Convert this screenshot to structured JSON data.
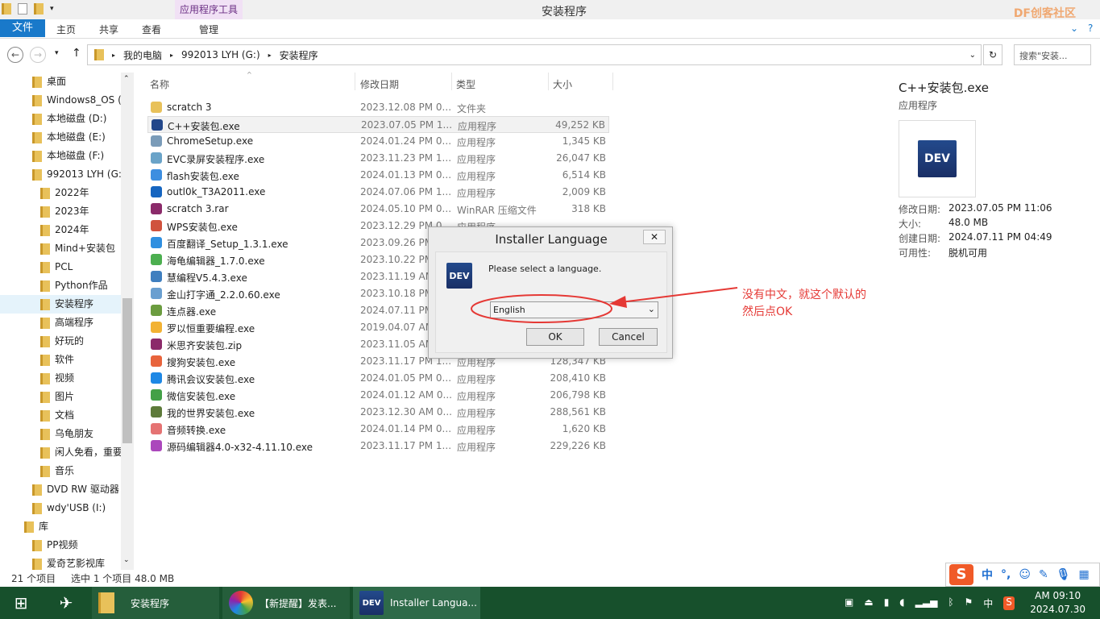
{
  "window": {
    "title": "安装程序",
    "context_tab": "应用程序工具",
    "watermark": "DF创客社区"
  },
  "ribbon": {
    "tabs": [
      "文件",
      "主页",
      "共享",
      "查看",
      "管理"
    ]
  },
  "address": {
    "crumbs": [
      "我的电脑",
      "992013 LYH (G:)",
      "安装程序"
    ],
    "search_placeholder": "搜索\"安装..."
  },
  "nav": [
    "桌面",
    "Windows8_OS (",
    "本地磁盘 (D:)",
    "本地磁盘 (E:)",
    "本地磁盘 (F:)",
    "992013 LYH (G:",
    "2022年",
    "2023年",
    "2024年",
    "Mind+安装包",
    "PCL",
    "Python作品",
    "安装程序",
    "高端程序",
    "好玩的",
    "软件",
    "视频",
    "图片",
    "文档",
    "乌龟朋友",
    "闲人免看，重要",
    "音乐",
    "DVD RW 驱动器",
    "wdy'USB (I:)",
    "库",
    "PP视频",
    "爱奇艺影视库"
  ],
  "columns": [
    "名称",
    "修改日期",
    "类型",
    "大小"
  ],
  "files": [
    {
      "name": "scratch 3",
      "date": "2023.12.08 PM 0...",
      "type": "文件夹",
      "size": "",
      "color": "#e8c15a"
    },
    {
      "name": "C++安装包.exe",
      "date": "2023.07.05 PM 1...",
      "type": "应用程序",
      "size": "49,252 KB",
      "color": "#23478a"
    },
    {
      "name": "ChromeSetup.exe",
      "date": "2024.01.24 PM 0...",
      "type": "应用程序",
      "size": "1,345 KB",
      "color": "#7a9bb8"
    },
    {
      "name": "EVC录屏安装程序.exe",
      "date": "2023.11.23 PM 1...",
      "type": "应用程序",
      "size": "26,047 KB",
      "color": "#6aa3c8"
    },
    {
      "name": "flash安装包.exe",
      "date": "2024.01.13 PM 0...",
      "type": "应用程序",
      "size": "6,514 KB",
      "color": "#3d8ee0"
    },
    {
      "name": "outl0k_T3A2011.exe",
      "date": "2024.07.06 PM 1...",
      "type": "应用程序",
      "size": "2,009 KB",
      "color": "#1565c0"
    },
    {
      "name": "scratch 3.rar",
      "date": "2024.05.10 PM 0...",
      "type": "WinRAR 压缩文件",
      "size": "318 KB",
      "color": "#8b2a6a"
    },
    {
      "name": "WPS安装包.exe",
      "date": "2023.12.29 PM 0...",
      "type": "应用程序",
      "size": "",
      "color": "#d0523d"
    },
    {
      "name": "百度翻译_Setup_1.3.1.exe",
      "date": "2023.09.26 PM",
      "type": "",
      "size": "",
      "color": "#2f8fe0"
    },
    {
      "name": "海龟编辑器_1.7.0.exe",
      "date": "2023.10.22 PM",
      "type": "",
      "size": "",
      "color": "#4caf50"
    },
    {
      "name": "慧编程V5.4.3.exe",
      "date": "2023.11.19 AM",
      "type": "",
      "size": "",
      "color": "#3f7fbf"
    },
    {
      "name": "金山打字通_2.2.0.60.exe",
      "date": "2023.10.18 PM",
      "type": "",
      "size": "",
      "color": "#6a9fd0"
    },
    {
      "name": "连点器.exe",
      "date": "2024.07.11 PM",
      "type": "",
      "size": "",
      "color": "#6b9c3f"
    },
    {
      "name": "罗以恒重要编程.exe",
      "date": "2019.04.07 AM",
      "type": "",
      "size": "",
      "color": "#f2b233"
    },
    {
      "name": "米思齐安装包.zip",
      "date": "2023.11.05 AM",
      "type": "",
      "size": "",
      "color": "#8b2a6a"
    },
    {
      "name": "搜狗安装包.exe",
      "date": "2023.11.17 PM 1...",
      "type": "应用程序",
      "size": "128,347 KB",
      "color": "#e8643c"
    },
    {
      "name": "腾讯会议安装包.exe",
      "date": "2024.01.05 PM 0...",
      "type": "应用程序",
      "size": "208,410 KB",
      "color": "#1e88e5"
    },
    {
      "name": "微信安装包.exe",
      "date": "2024.01.12 AM 0...",
      "type": "应用程序",
      "size": "206,798 KB",
      "color": "#43a047"
    },
    {
      "name": "我的世界安装包.exe",
      "date": "2023.12.30 AM 0...",
      "type": "应用程序",
      "size": "288,561 KB",
      "color": "#5d7a3a"
    },
    {
      "name": "音频转换.exe",
      "date": "2024.01.14 PM 0...",
      "type": "应用程序",
      "size": "1,620 KB",
      "color": "#e57373"
    },
    {
      "name": "源码编辑器4.0-x32-4.11.10.exe",
      "date": "2023.11.17 PM 1...",
      "type": "应用程序",
      "size": "229,226 KB",
      "color": "#ab47bc"
    }
  ],
  "preview": {
    "name": "C++安装包.exe",
    "type": "应用程序",
    "logo": "DEV",
    "props": [
      [
        "修改日期:",
        "2023.07.05 PM 11:06"
      ],
      [
        "大小:",
        "48.0 MB"
      ],
      [
        "创建日期:",
        "2024.07.11 PM 04:49"
      ],
      [
        "可用性:",
        "脱机可用"
      ]
    ]
  },
  "dialog": {
    "title": "Installer Language",
    "close": "✕",
    "message": "Please select a language.",
    "logo": "DEV",
    "selected": "English",
    "ok": "OK",
    "cancel": "Cancel"
  },
  "annotation": {
    "line1": "没有中文，就这个默认的",
    "line2": "然后点OK",
    "color": "#e53935"
  },
  "status": {
    "count": "21 个项目",
    "selected": "选中 1 个项目 48.0 MB"
  },
  "taskbar": {
    "items": [
      "安装程序",
      "【新提醒】发表...",
      "Installer Langua..."
    ],
    "time": "AM 09:10",
    "date": "2024.07.30",
    "tray_lang": "中"
  },
  "ime": {
    "mode": "中",
    "punct": "°,"
  }
}
